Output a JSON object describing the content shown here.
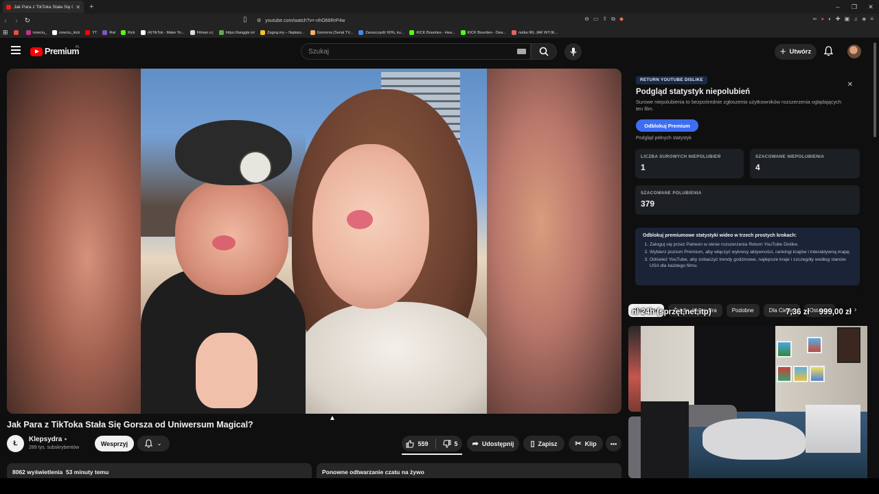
{
  "browser": {
    "tab_title": "Jak Para z TikToka Stała Się G...",
    "new_tab": "+",
    "url": "youtube.com/watch?v=-nhO66RrP4w",
    "bookmarks": [
      {
        "label": "",
        "color": "#e8503a"
      },
      {
        "label": "nowciu_",
        "color": "#c13584"
      },
      {
        "label": "nowciu_kick",
        "color": "#ffffff"
      },
      {
        "label": "YT",
        "color": "#ff0000"
      },
      {
        "label": "Rat",
        "color": "#7e57c2"
      },
      {
        "label": "Kick",
        "color": "#53fc18"
      },
      {
        "label": "(4)TikTok - Make Yo...",
        "color": "#ffffff"
      },
      {
        "label": "Filman.cc",
        "color": "#dddddd"
      },
      {
        "label": "https://tanggle.io/",
        "color": "#6aa84f"
      },
      {
        "label": "Zagraj.my – Najleps...",
        "color": "#f1c232"
      },
      {
        "label": "Gomorra (Serial TV...",
        "color": "#f6b26b"
      },
      {
        "label": "Zaoszczędź 60%, ku...",
        "color": "#4a86e8"
      },
      {
        "label": "KICK Bounties - Hea...",
        "color": "#53fc18"
      },
      {
        "label": "KICK Bounties - Dea...",
        "color": "#53fc18"
      },
      {
        "label": "nutka IRL JAK WYJE...",
        "color": "#e06666"
      }
    ]
  },
  "header": {
    "logo_text": "Premium",
    "country": "PL",
    "search_placeholder": "Szukaj",
    "create_label": "Utwórz"
  },
  "video": {
    "title": "Jak Para z TikToka Stała Się Gorsza od Uniwersum Magical?",
    "channel_initial": "Ł",
    "channel_name": "Klepsydra",
    "subscribers": "289 tys. subskrybentów",
    "support_label": "Wesprzyj",
    "likes": "559",
    "dislikes": "5",
    "share_label": "Udostępnij",
    "save_label": "Zapisz",
    "clip_label": "Klip",
    "views_time": "8062 wyświetlenia  53 minuty temu",
    "chat_replay": "Ponowne odtwarzanie czatu na żywo"
  },
  "ryd": {
    "badge": "RETURN YOUTUBE DISLIKE",
    "title": "Podgląd statystyk niepolubień",
    "desc": "Surowe niepolubienia to bezpośrednie zgłoszenia użytkowników rozszerzenia oglądających ten film.",
    "unlock_btn": "Odblokuj Premium",
    "full_stats": "Podgląd pełnych statystyk",
    "raw_dislikes_label": "LICZBA SUROWYCH NIEPOLUBIEŃ",
    "raw_dislikes_value": "1",
    "est_dislikes_label": "SZACOWANE NIEPOLUBIENIA",
    "est_dislikes_value": "4",
    "est_likes_label": "SZACOWANE POLUBIENIA",
    "est_likes_value": "379",
    "steps_heading": "Odblokuj premiumowe statystyki wideo w trzech prostych krokach:",
    "steps": [
      "Zaloguj się przez Patreon w oknie rozszerzenia Return YouTube Dislike.",
      "Wybierz poziom Premium, aby włączyć wykresy aktywności, rankingi krajów i interaktywną mapę.",
      "Odśwież YouTube, aby zobaczyć trendy godzinowe, najlepsze kraje i szczegóły według stanów USA dla każdego filmu."
    ]
  },
  "chips": [
    "Wszystkie",
    "Źródło: Klepsydra",
    "Podobne",
    "Dla Ciebie",
    "Ostatnio"
  ],
  "overlay": {
    "left": "nl 24h (sprzęt,net,itp)",
    "mid": "7,36 zł",
    "right": "999,00 zł"
  }
}
